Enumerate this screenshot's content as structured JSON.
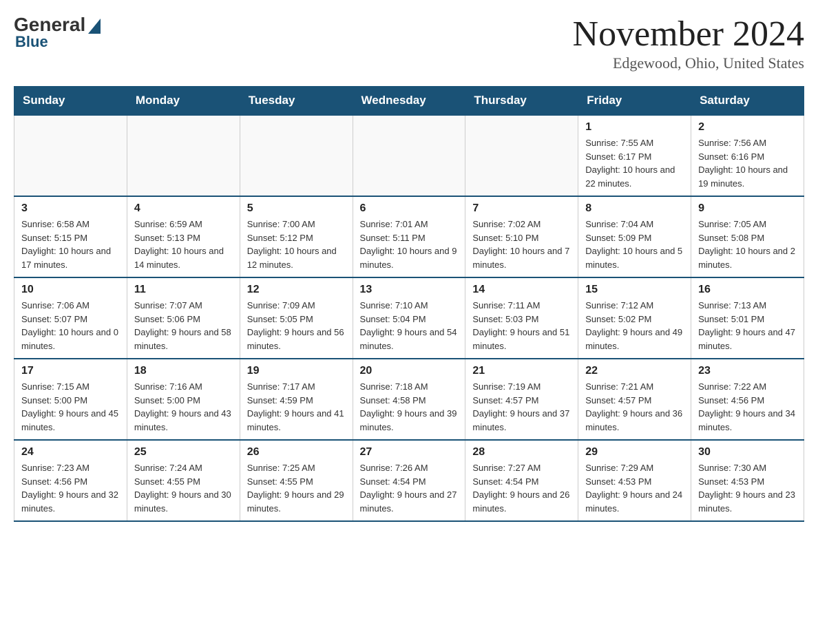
{
  "logo": {
    "general": "General",
    "blue": "Blue"
  },
  "header": {
    "month_year": "November 2024",
    "location": "Edgewood, Ohio, United States"
  },
  "weekdays": [
    "Sunday",
    "Monday",
    "Tuesday",
    "Wednesday",
    "Thursday",
    "Friday",
    "Saturday"
  ],
  "weeks": [
    [
      {
        "day": "",
        "info": ""
      },
      {
        "day": "",
        "info": ""
      },
      {
        "day": "",
        "info": ""
      },
      {
        "day": "",
        "info": ""
      },
      {
        "day": "",
        "info": ""
      },
      {
        "day": "1",
        "info": "Sunrise: 7:55 AM\nSunset: 6:17 PM\nDaylight: 10 hours and 22 minutes."
      },
      {
        "day": "2",
        "info": "Sunrise: 7:56 AM\nSunset: 6:16 PM\nDaylight: 10 hours and 19 minutes."
      }
    ],
    [
      {
        "day": "3",
        "info": "Sunrise: 6:58 AM\nSunset: 5:15 PM\nDaylight: 10 hours and 17 minutes."
      },
      {
        "day": "4",
        "info": "Sunrise: 6:59 AM\nSunset: 5:13 PM\nDaylight: 10 hours and 14 minutes."
      },
      {
        "day": "5",
        "info": "Sunrise: 7:00 AM\nSunset: 5:12 PM\nDaylight: 10 hours and 12 minutes."
      },
      {
        "day": "6",
        "info": "Sunrise: 7:01 AM\nSunset: 5:11 PM\nDaylight: 10 hours and 9 minutes."
      },
      {
        "day": "7",
        "info": "Sunrise: 7:02 AM\nSunset: 5:10 PM\nDaylight: 10 hours and 7 minutes."
      },
      {
        "day": "8",
        "info": "Sunrise: 7:04 AM\nSunset: 5:09 PM\nDaylight: 10 hours and 5 minutes."
      },
      {
        "day": "9",
        "info": "Sunrise: 7:05 AM\nSunset: 5:08 PM\nDaylight: 10 hours and 2 minutes."
      }
    ],
    [
      {
        "day": "10",
        "info": "Sunrise: 7:06 AM\nSunset: 5:07 PM\nDaylight: 10 hours and 0 minutes."
      },
      {
        "day": "11",
        "info": "Sunrise: 7:07 AM\nSunset: 5:06 PM\nDaylight: 9 hours and 58 minutes."
      },
      {
        "day": "12",
        "info": "Sunrise: 7:09 AM\nSunset: 5:05 PM\nDaylight: 9 hours and 56 minutes."
      },
      {
        "day": "13",
        "info": "Sunrise: 7:10 AM\nSunset: 5:04 PM\nDaylight: 9 hours and 54 minutes."
      },
      {
        "day": "14",
        "info": "Sunrise: 7:11 AM\nSunset: 5:03 PM\nDaylight: 9 hours and 51 minutes."
      },
      {
        "day": "15",
        "info": "Sunrise: 7:12 AM\nSunset: 5:02 PM\nDaylight: 9 hours and 49 minutes."
      },
      {
        "day": "16",
        "info": "Sunrise: 7:13 AM\nSunset: 5:01 PM\nDaylight: 9 hours and 47 minutes."
      }
    ],
    [
      {
        "day": "17",
        "info": "Sunrise: 7:15 AM\nSunset: 5:00 PM\nDaylight: 9 hours and 45 minutes."
      },
      {
        "day": "18",
        "info": "Sunrise: 7:16 AM\nSunset: 5:00 PM\nDaylight: 9 hours and 43 minutes."
      },
      {
        "day": "19",
        "info": "Sunrise: 7:17 AM\nSunset: 4:59 PM\nDaylight: 9 hours and 41 minutes."
      },
      {
        "day": "20",
        "info": "Sunrise: 7:18 AM\nSunset: 4:58 PM\nDaylight: 9 hours and 39 minutes."
      },
      {
        "day": "21",
        "info": "Sunrise: 7:19 AM\nSunset: 4:57 PM\nDaylight: 9 hours and 37 minutes."
      },
      {
        "day": "22",
        "info": "Sunrise: 7:21 AM\nSunset: 4:57 PM\nDaylight: 9 hours and 36 minutes."
      },
      {
        "day": "23",
        "info": "Sunrise: 7:22 AM\nSunset: 4:56 PM\nDaylight: 9 hours and 34 minutes."
      }
    ],
    [
      {
        "day": "24",
        "info": "Sunrise: 7:23 AM\nSunset: 4:56 PM\nDaylight: 9 hours and 32 minutes."
      },
      {
        "day": "25",
        "info": "Sunrise: 7:24 AM\nSunset: 4:55 PM\nDaylight: 9 hours and 30 minutes."
      },
      {
        "day": "26",
        "info": "Sunrise: 7:25 AM\nSunset: 4:55 PM\nDaylight: 9 hours and 29 minutes."
      },
      {
        "day": "27",
        "info": "Sunrise: 7:26 AM\nSunset: 4:54 PM\nDaylight: 9 hours and 27 minutes."
      },
      {
        "day": "28",
        "info": "Sunrise: 7:27 AM\nSunset: 4:54 PM\nDaylight: 9 hours and 26 minutes."
      },
      {
        "day": "29",
        "info": "Sunrise: 7:29 AM\nSunset: 4:53 PM\nDaylight: 9 hours and 24 minutes."
      },
      {
        "day": "30",
        "info": "Sunrise: 7:30 AM\nSunset: 4:53 PM\nDaylight: 9 hours and 23 minutes."
      }
    ]
  ]
}
